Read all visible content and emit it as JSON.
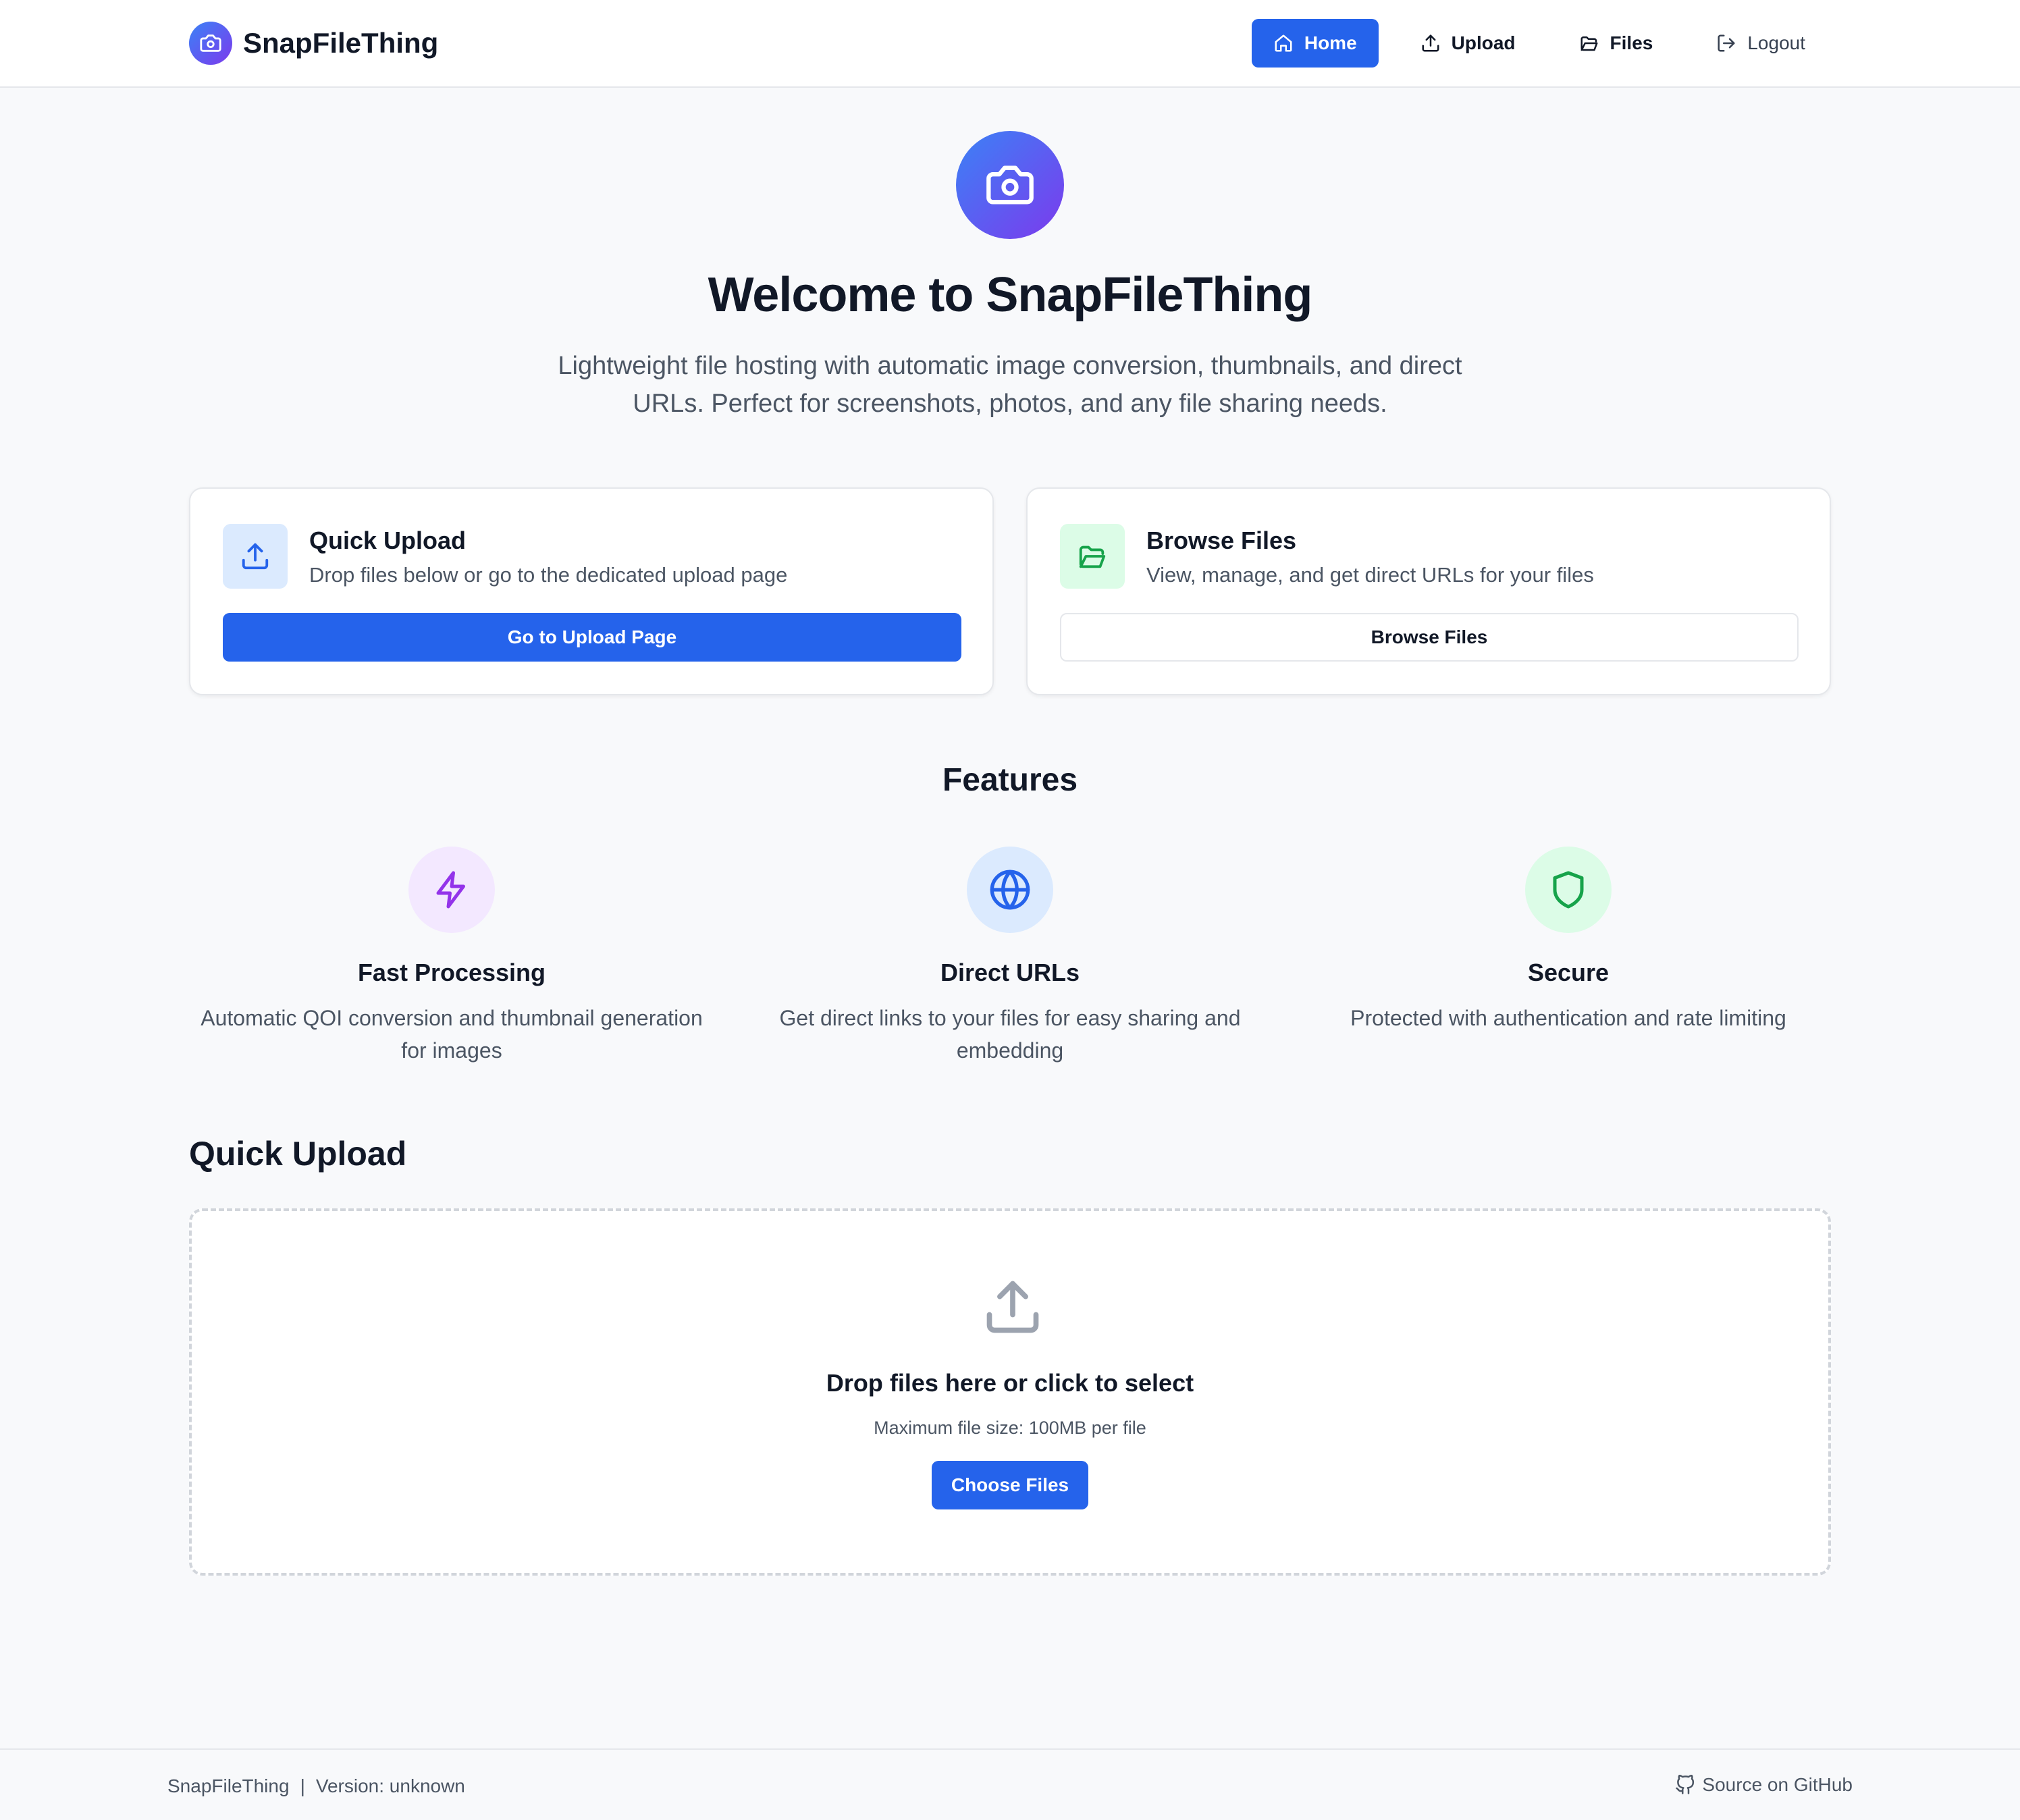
{
  "header": {
    "app_name": "SnapFileThing",
    "logo_icon": "camera-icon",
    "nav": [
      {
        "label": "Home",
        "icon": "home-icon",
        "active": true
      },
      {
        "label": "Upload",
        "icon": "upload-icon",
        "active": false
      },
      {
        "label": "Files",
        "icon": "folder-open-icon",
        "active": false
      },
      {
        "label": "Logout",
        "icon": "logout-icon",
        "active": false
      }
    ]
  },
  "hero": {
    "icon": "camera-icon",
    "title": "Welcome to SnapFileThing",
    "subtitle": "Lightweight file hosting with automatic image conversion, thumbnails, and direct URLs. Perfect for screenshots, photos, and any file sharing needs."
  },
  "cards": [
    {
      "title": "Quick Upload",
      "description": "Drop files below or go to the dedicated upload page",
      "button": "Go to Upload Page",
      "icon": "upload-icon"
    },
    {
      "title": "Browse Files",
      "description": "View, manage, and get direct URLs for your files",
      "button": "Browse Files",
      "icon": "folder-open-icon"
    }
  ],
  "features": {
    "title": "Features",
    "items": [
      {
        "title": "Fast Processing",
        "description": "Automatic QOI conversion and thumbnail generation for images",
        "icon": "lightning-icon"
      },
      {
        "title": "Direct URLs",
        "description": "Get direct links to your files for easy sharing and embedding",
        "icon": "globe-icon"
      },
      {
        "title": "Secure",
        "description": "Protected with authentication and rate limiting",
        "icon": "shield-icon"
      }
    ]
  },
  "quick_upload": {
    "title": "Quick Upload",
    "drop_title": "Drop files here or click to select",
    "hint": "Maximum file size: 100MB per file",
    "button": "Choose Files",
    "icon": "upload-icon"
  },
  "footer": {
    "app_name": "SnapFileThing",
    "separator": "|",
    "version": "Version: unknown",
    "source_link": "Source on GitHub",
    "source_icon": "github-icon"
  },
  "colors": {
    "primary": "#2563eb",
    "brand_gradient_start": "#3b82f6",
    "brand_gradient_end": "#7c3aed",
    "background": "#f8f9fb",
    "success": "#16a34a",
    "accent_purple": "#9333ea"
  }
}
